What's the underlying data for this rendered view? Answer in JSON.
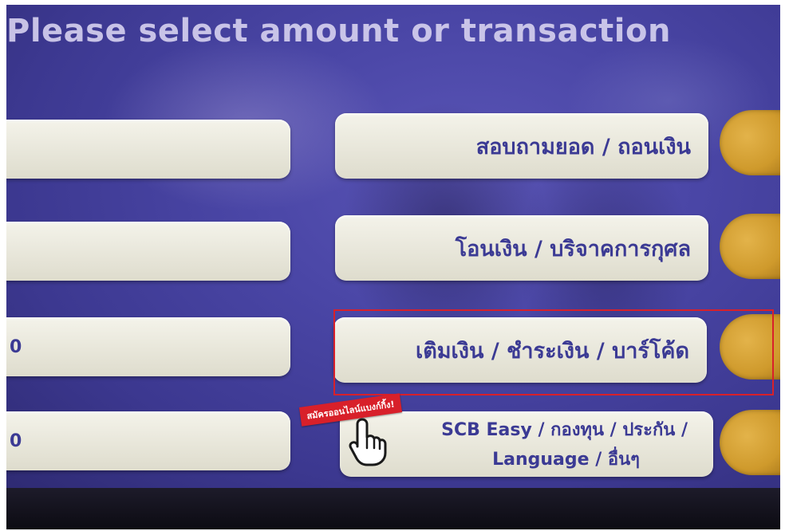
{
  "screen": {
    "prompt": "Please select amount or transaction"
  },
  "left_buttons": [
    {
      "label": ""
    },
    {
      "label": ""
    },
    {
      "label": "0"
    },
    {
      "label": "0"
    }
  ],
  "right_buttons": [
    {
      "label": "สอบถามยอด / ถอนเงิน"
    },
    {
      "label": "โอนเงิน / บริจาคการกุศล"
    },
    {
      "label": "เติมเงิน / ชำระเงิน / บาร์โค้ด"
    },
    {
      "line1": "SCB Easy / กองทุน / ประกัน /",
      "line2": "Language / อื่นๆ"
    }
  ],
  "promo": {
    "text": "สมัครออนไลน์แบงก์กิ้ง!"
  },
  "colors": {
    "screen_bg": "#4a46a6",
    "button_face": "#f4f3ea",
    "button_text": "#3b3a94",
    "side_key": "#cf9a2c",
    "highlight": "#d8202a"
  },
  "icons": {
    "pointer": "hand-pointer-icon"
  }
}
